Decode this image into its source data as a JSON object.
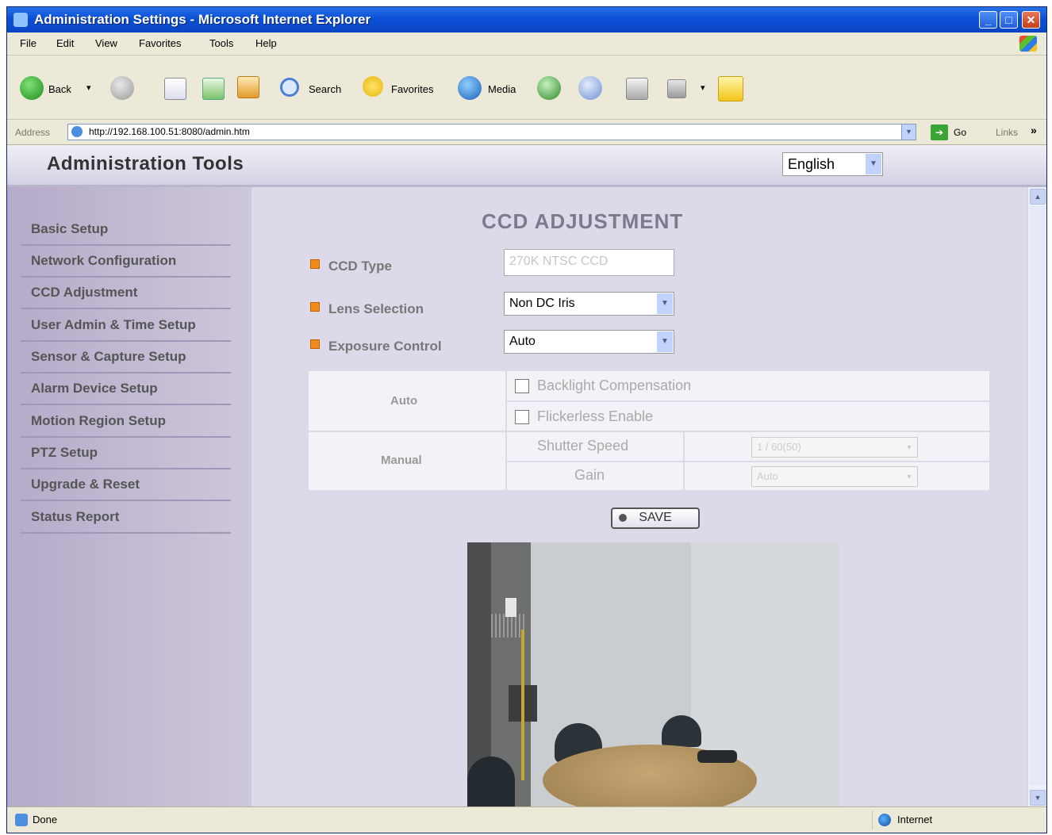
{
  "window": {
    "title": "Administration Settings - Microsoft Internet Explorer",
    "minimize_glyph": "_",
    "maximize_glyph": "□",
    "close_glyph": "✕"
  },
  "menu": [
    "File",
    "Edit",
    "View",
    "Favorites",
    "Tools",
    "Help"
  ],
  "toolbar": {
    "back": "Back",
    "back_dropdown": "▾",
    "search": "Search",
    "favorites": "Favorites",
    "media": "Media",
    "more_dropdown": "▾"
  },
  "address_bar": {
    "label": "Address",
    "url": "http://192.168.100.51:8080/admin.htm",
    "dropdown_glyph": "▼",
    "go_glyph": "➔",
    "go_label": "Go",
    "links_label": "Links",
    "chevron": "»"
  },
  "app": {
    "header_title": "Administration Tools",
    "language": "English",
    "select_glyph": "▼"
  },
  "sidebar": {
    "items": [
      {
        "label": "Basic Setup"
      },
      {
        "label": "Network Configuration"
      },
      {
        "label": "CCD Adjustment"
      },
      {
        "label": "User Admin & Time Setup"
      },
      {
        "label": "Sensor & Capture Setup"
      },
      {
        "label": "Alarm Device Setup"
      },
      {
        "label": "Motion Region Setup"
      },
      {
        "label": "PTZ Setup"
      },
      {
        "label": "Upgrade & Reset"
      },
      {
        "label": "Status Report"
      }
    ]
  },
  "ccd": {
    "section_title": "CCD ADJUSTMENT",
    "ccd_type_label": "CCD Type",
    "ccd_type_value": "270K NTSC CCD",
    "lens_label": "Lens Selection",
    "lens_value": "Non DC Iris",
    "exposure_label": "Exposure Control",
    "exposure_value": "Auto",
    "auto_label": "Auto",
    "backlight_label": "Backlight Compensation",
    "flickerless_label": "Flickerless Enable",
    "manual_label": "Manual",
    "shutter_label": "Shutter Speed",
    "shutter_value": "1 / 60(50)",
    "gain_label": "Gain",
    "gain_value": "Auto",
    "save_label": "SAVE"
  },
  "status_bar": {
    "text": "Done",
    "zone": "Internet"
  },
  "scroll": {
    "up_glyph": "▲",
    "down_glyph": "▼"
  },
  "colors": {
    "title_bar": "#0b4fd6",
    "sidebar": "#b5aac9",
    "main_bg": "#dcd9e8",
    "bullet": "#f08a1a"
  }
}
